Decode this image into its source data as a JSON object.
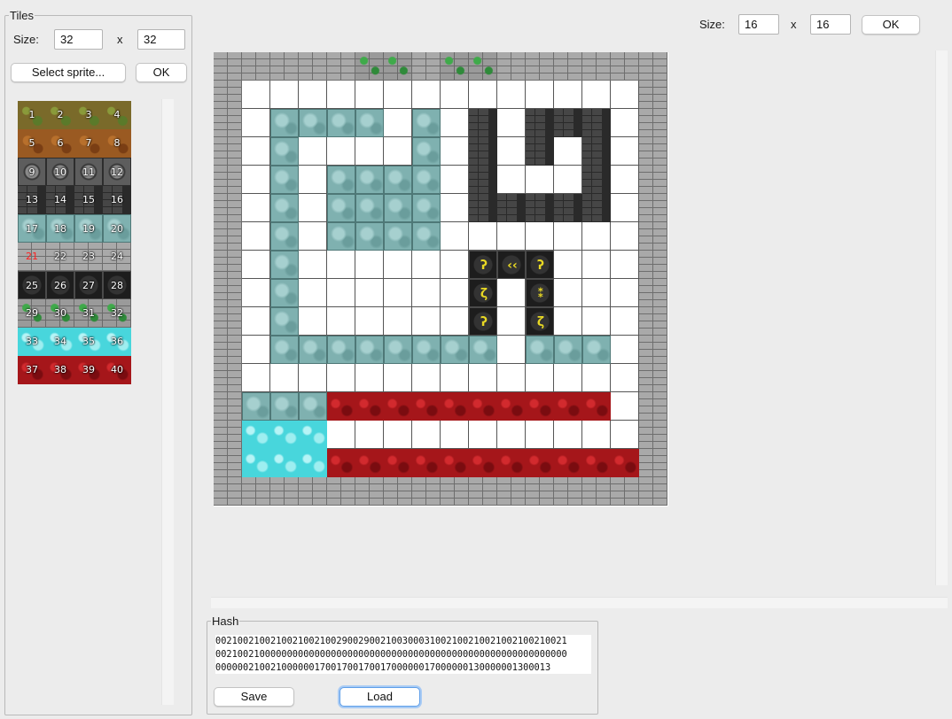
{
  "tiles_panel": {
    "title": "Tiles",
    "size_label": "Size:",
    "width": "32",
    "times": "x",
    "height": "32",
    "select_sprite_label": "Select sprite...",
    "ok_label": "OK",
    "palette": {
      "numbers": [
        "1",
        "2",
        "3",
        "4",
        "5",
        "6",
        "7",
        "8",
        "9",
        "10",
        "11",
        "12",
        "13",
        "14",
        "15",
        "16",
        "17",
        "18",
        "19",
        "20",
        "21",
        "22",
        "23",
        "24",
        "25",
        "26",
        "27",
        "28",
        "29",
        "30",
        "31",
        "32",
        "33",
        "34",
        "35",
        "36",
        "37",
        "38",
        "39",
        "40"
      ],
      "selected_tile": "21"
    }
  },
  "map_toolbar": {
    "size_label": "Size:",
    "width": "16",
    "times": "x",
    "height": "16",
    "ok_label": "OK"
  },
  "map": {
    "cols": 16,
    "rows": 16,
    "cells": [
      [
        21,
        21,
        21,
        21,
        21,
        29,
        29,
        21,
        30,
        30,
        21,
        21,
        21,
        21,
        21,
        21
      ],
      [
        21,
        0,
        0,
        0,
        0,
        0,
        0,
        0,
        0,
        0,
        0,
        0,
        0,
        0,
        0,
        21
      ],
      [
        21,
        0,
        17,
        17,
        17,
        17,
        0,
        17,
        0,
        13,
        0,
        13,
        13,
        13,
        0,
        21
      ],
      [
        21,
        0,
        17,
        0,
        0,
        0,
        0,
        17,
        0,
        13,
        0,
        13,
        0,
        13,
        0,
        21
      ],
      [
        21,
        0,
        17,
        0,
        17,
        17,
        17,
        17,
        0,
        13,
        0,
        0,
        0,
        13,
        0,
        21
      ],
      [
        21,
        0,
        17,
        0,
        17,
        17,
        17,
        17,
        0,
        13,
        13,
        13,
        13,
        13,
        0,
        21
      ],
      [
        21,
        0,
        17,
        0,
        17,
        17,
        17,
        17,
        0,
        0,
        0,
        0,
        0,
        0,
        0,
        21
      ],
      [
        21,
        0,
        17,
        0,
        0,
        0,
        0,
        0,
        0,
        25,
        26,
        25,
        0,
        0,
        0,
        21
      ],
      [
        21,
        0,
        17,
        0,
        0,
        0,
        0,
        0,
        0,
        27,
        0,
        28,
        0,
        0,
        0,
        21
      ],
      [
        21,
        0,
        17,
        0,
        0,
        0,
        0,
        0,
        0,
        25,
        0,
        27,
        0,
        0,
        0,
        21
      ],
      [
        21,
        0,
        17,
        17,
        17,
        17,
        17,
        17,
        17,
        17,
        0,
        17,
        17,
        17,
        0,
        21
      ],
      [
        21,
        0,
        0,
        0,
        0,
        0,
        0,
        0,
        0,
        0,
        0,
        0,
        0,
        0,
        0,
        21
      ],
      [
        21,
        17,
        17,
        17,
        37,
        37,
        37,
        37,
        37,
        37,
        37,
        37,
        37,
        37,
        0,
        21
      ],
      [
        21,
        33,
        33,
        33,
        0,
        0,
        0,
        0,
        0,
        0,
        0,
        0,
        0,
        0,
        0,
        21
      ],
      [
        21,
        33,
        33,
        33,
        37,
        37,
        37,
        37,
        37,
        37,
        37,
        37,
        37,
        37,
        37,
        21
      ],
      [
        21,
        21,
        21,
        21,
        21,
        21,
        21,
        21,
        21,
        21,
        21,
        21,
        21,
        21,
        21,
        21
      ]
    ]
  },
  "hash_panel": {
    "title": "Hash",
    "text": "0021002100210021002100290029002100300031002100210021002100210021\n0021002100000000000000000000000000000000000000000000000000000000\n0000002100210000001700170017001700000017000000130000001300013",
    "save_label": "Save",
    "load_label": "Load"
  },
  "tile_colors": {
    "dirt_green": "#7a6a2a",
    "dirt_brown": "#9a5a22",
    "ornate_stone": "#5d5d5d",
    "dark_stone": "#464646",
    "teal_marble": "#7fb1b0",
    "gray_brick": "#a9a9a9",
    "rune_black": "#1d1d1d",
    "mossy_brick": "#6f8f5f",
    "cyan_water": "#48d6dc",
    "red_lava": "#a5161a"
  }
}
